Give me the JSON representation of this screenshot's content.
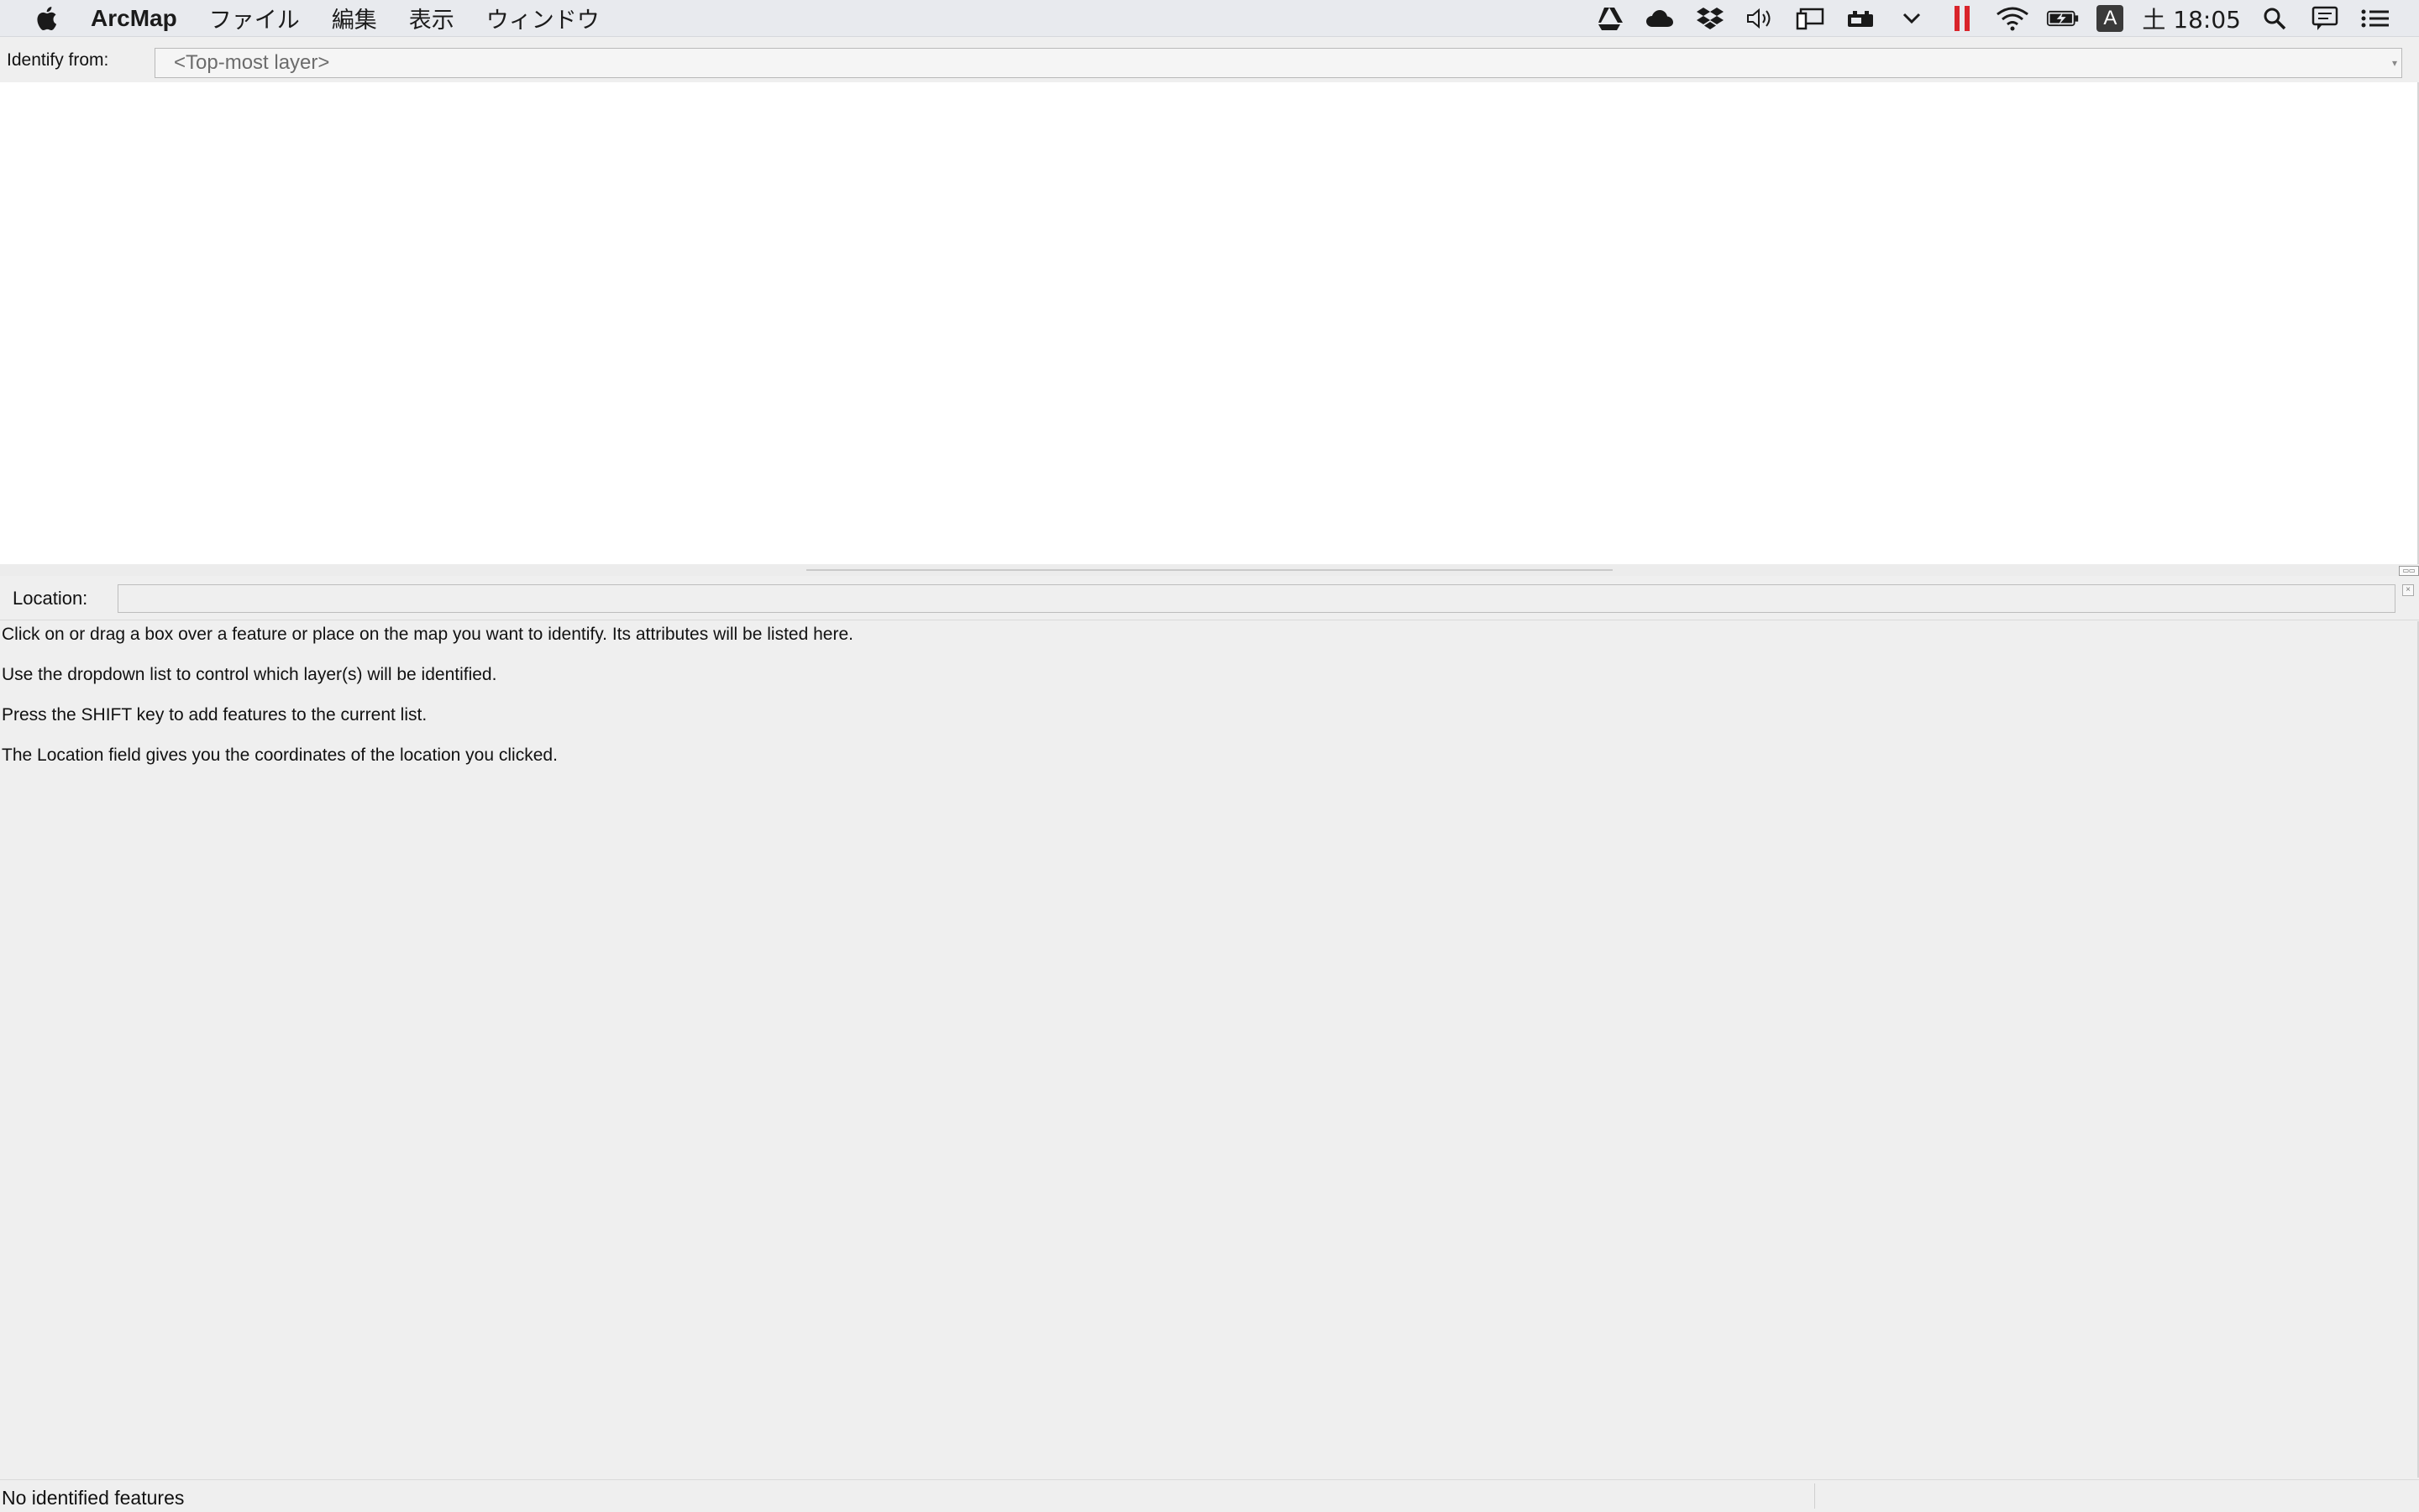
{
  "menubar": {
    "app_name": "ArcMap",
    "menus": [
      {
        "label": "ファイル"
      },
      {
        "label": "編集"
      },
      {
        "label": "表示"
      },
      {
        "label": "ウィンドウ"
      }
    ],
    "clock": "土 18:05",
    "ime_badge": "A",
    "status_icons": [
      "google-drive-icon",
      "cloud-icon",
      "dropbox-icon",
      "volume-icon",
      "display-icon",
      "battery-device-icon",
      "chevron-down-icon",
      "pause-recording-icon",
      "wifi-icon",
      "battery-icon",
      "input-method-icon",
      "spotlight-search-icon",
      "notification-icon",
      "control-list-icon"
    ],
    "accent_red": "#d9242b"
  },
  "identify": {
    "label": "Identify from:",
    "layer_value": "<Top-most layer>"
  },
  "location": {
    "label": "Location:",
    "value": ""
  },
  "instructions": [
    "Click on or drag a box over a feature or place on the map you want to identify. Its attributes will be listed here.",
    "Use the dropdown list to control which layer(s) will be identified.",
    "Press the SHIFT key to add features to the current list.",
    "The Location field gives you the coordinates of the location you clicked."
  ],
  "status": {
    "text": "No identified features"
  }
}
